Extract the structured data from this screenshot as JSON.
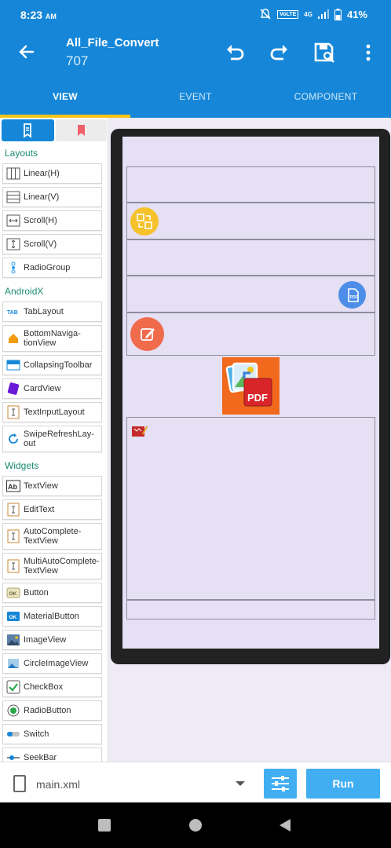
{
  "status": {
    "time": "8:23",
    "ampm": "AM",
    "network": "VoLTE",
    "signal": "4G",
    "battery": "41%"
  },
  "appbar": {
    "title": "All_File_Convert",
    "subtitle": "707"
  },
  "tabs": [
    "VIEW",
    "EVENT",
    "COMPONENT"
  ],
  "palette": {
    "sections": {
      "layouts": "Layouts",
      "androidx": "AndroidX",
      "widgets": "Widgets"
    },
    "layouts": [
      "Linear(H)",
      "Linear(V)",
      "Scroll(H)",
      "Scroll(V)",
      "RadioGroup"
    ],
    "androidx": [
      "TabLayout",
      "BottomNaviga-tionView",
      "CollapsingToolbar",
      "CardView",
      "TextInputLayout",
      "SwipeRefreshLay-out"
    ],
    "widgets": [
      "TextView",
      "EditText",
      "AutoComplete-TextView",
      "MultiAutoComplete-TextView",
      "Button",
      "MaterialButton",
      "ImageView",
      "CircleImageView",
      "CheckBox",
      "RadioButton",
      "Switch",
      "SeekBar"
    ]
  },
  "preview": {
    "pdf_label": "PDF"
  },
  "bottom": {
    "file": "main.xml",
    "run": "Run"
  },
  "colors": {
    "primary": "#1687d8",
    "accent": "#f5c518",
    "run": "#42aef2"
  }
}
